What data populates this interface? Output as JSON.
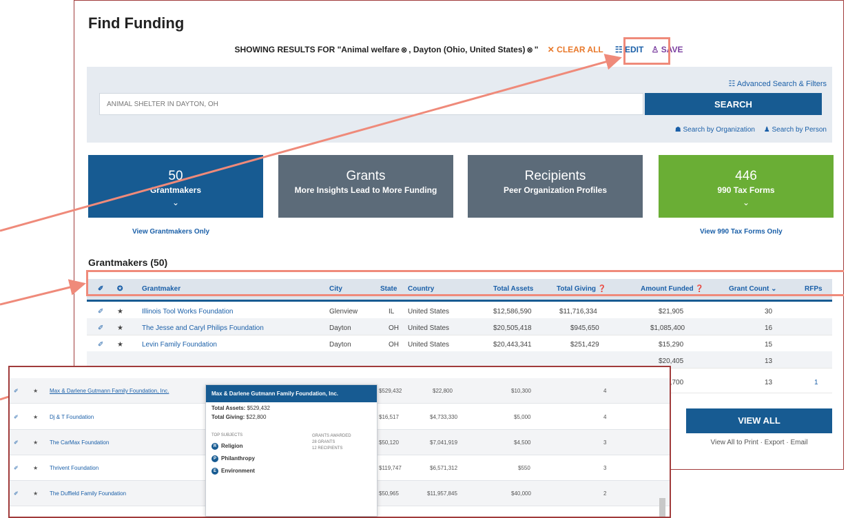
{
  "page": {
    "title": "Find Funding"
  },
  "showing": {
    "prefix": "SHOWING RESULTS FOR \"Animal welfare",
    "x1": "⊗",
    "mid": ", Dayton (Ohio, United States)",
    "x2": "⊗",
    "suffix": "\"",
    "clear": "✕ CLEAR ALL",
    "edit": "☷ EDIT",
    "save": "♙ SAVE"
  },
  "search": {
    "advanced": "☷ Advanced Search & Filters",
    "value": "ANIMAL SHELTER IN DAYTON, OH",
    "button": "SEARCH",
    "by_org": "☗ Search by Organization",
    "by_person": "♟ Search by Person"
  },
  "cards": [
    {
      "big": "50",
      "small": "Grantmakers",
      "chev": "⌄"
    },
    {
      "big": "Grants",
      "small": "More Insights Lead to More Funding",
      "chev": ""
    },
    {
      "big": "Recipients",
      "small": "Peer Organization Profiles",
      "chev": ""
    },
    {
      "big": "446",
      "small": "990 Tax Forms",
      "chev": "⌄"
    }
  ],
  "links": {
    "grantmakers_only": "View Grantmakers Only",
    "forms_only": "View 990 Tax Forms Only"
  },
  "section": {
    "title": "Grantmakers (50)"
  },
  "table": {
    "headers": {
      "icon1": "✐",
      "icon2": "✪",
      "grantmaker": "Grantmaker",
      "city": "City",
      "state": "State",
      "country": "Country",
      "assets": "Total Assets",
      "giving": "Total Giving ❓",
      "funded": "Amount Funded ❓",
      "count": "Grant Count ⌄",
      "rfps": "RFPs"
    },
    "rows": [
      {
        "name": "Illinois Tool Works Foundation",
        "city": "Glenview",
        "state": "IL",
        "country": "United States",
        "assets": "$12,586,590",
        "giving": "$11,716,334",
        "funded": "$21,905",
        "count": "30",
        "rfps": ""
      },
      {
        "name": "The Jesse and Caryl Philips Foundation",
        "city": "Dayton",
        "state": "OH",
        "country": "United States",
        "assets": "$20,505,418",
        "giving": "$945,650",
        "funded": "$1,085,400",
        "count": "16",
        "rfps": ""
      },
      {
        "name": "Levin Family Foundation",
        "city": "Dayton",
        "state": "OH",
        "country": "United States",
        "assets": "$20,443,341",
        "giving": "$251,429",
        "funded": "$15,290",
        "count": "15",
        "rfps": ""
      },
      {
        "name": "",
        "city": "",
        "state": "",
        "country": "",
        "assets": "",
        "giving": "",
        "funded": "$20,405",
        "count": "13",
        "rfps": ""
      },
      {
        "name": "",
        "city": "",
        "state": "",
        "country": "",
        "assets": "",
        "giving": "",
        "funded": "$14,700",
        "count": "13",
        "rfps": "1"
      }
    ]
  },
  "viewall": {
    "label": "VIEW ALL",
    "sub": "View All to Print · Export · Email"
  },
  "overlay": {
    "rows": [
      {
        "name": "Max & Darlene Gutmann Family Foundation, Inc.",
        "assets": "$529,432",
        "giving": "$22,800",
        "funded": "$10,300",
        "count": "4"
      },
      {
        "name": "Dj & T Foundation",
        "assets": "$16,517",
        "giving": "$4,733,330",
        "funded": "$5,000",
        "count": "4"
      },
      {
        "name": "The CarMax Foundation",
        "assets": "$50,120",
        "giving": "$7,041,919",
        "funded": "$4,500",
        "count": "3"
      },
      {
        "name": "Thrivent Foundation",
        "assets": "$119,747",
        "giving": "$6,571,312",
        "funded": "$550",
        "count": "3"
      },
      {
        "name": "The Duffield Family Foundation",
        "assets": "$50,965",
        "giving": "$11,957,845",
        "funded": "$40,000",
        "count": "2"
      },
      {
        "name": "",
        "assets": "",
        "giving": "",
        "funded": "",
        "count": ""
      }
    ],
    "popup": {
      "title": "Max & Darlene Gutmann Family Foundation, Inc.",
      "assets_label": "Total Assets:",
      "assets": "$529,432",
      "giving_label": "Total Giving:",
      "giving": "$22,800",
      "subjects_label": "TOP SUBJECTS",
      "awarded_label": "GRANTS AWARDED",
      "awarded_grants": "28 GRANTS",
      "awarded_recipients": "12 RECIPIENTS",
      "subjects": [
        {
          "mark": "R",
          "name": "Religion"
        },
        {
          "mark": "P",
          "name": "Philanthropy"
        },
        {
          "mark": "E",
          "name": "Environment"
        }
      ]
    }
  },
  "row_icons": {
    "edit": "✐",
    "star": "★"
  },
  "colors": {
    "primary": "#175b92",
    "card_gray": "#5c6b79",
    "card_green": "#6aae35",
    "highlight": "#ef8a7a",
    "frame": "#a03a3a"
  }
}
